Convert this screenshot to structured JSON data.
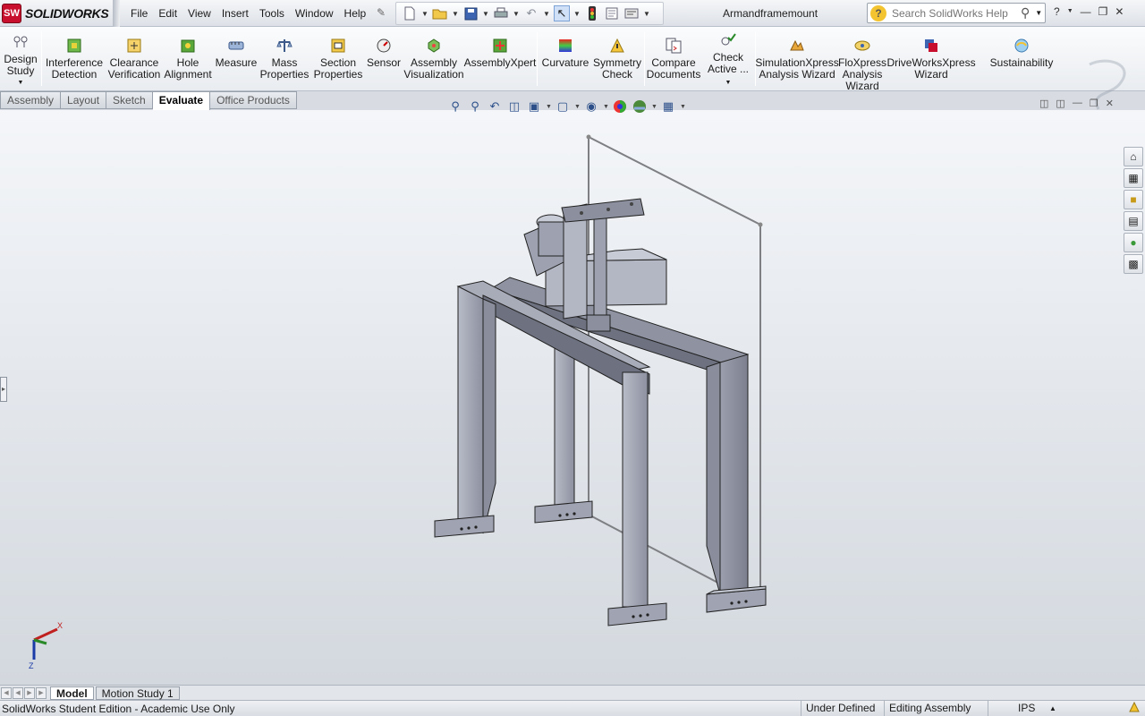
{
  "app": {
    "name": "SOLIDWORKS",
    "logo_mark": "SW",
    "document_title": "Armandframemount"
  },
  "menu": [
    "File",
    "Edit",
    "View",
    "Insert",
    "Tools",
    "Window",
    "Help"
  ],
  "quick_access": [
    "new-document-icon",
    "open-folder-icon",
    "save-icon",
    "print-icon",
    "undo-icon",
    "select-arrow-icon",
    "rebuild-traffic-light-icon",
    "options-icon"
  ],
  "search": {
    "placeholder": "Search SolidWorks Help"
  },
  "ribbon": {
    "buttons": [
      {
        "label": "Design Study",
        "icon": "design-study-icon"
      },
      {
        "label": "Interference Detection",
        "icon": "interference-detection-icon"
      },
      {
        "label": "Clearance Verification",
        "icon": "clearance-verification-icon"
      },
      {
        "label": "Hole Alignment",
        "icon": "hole-alignment-icon"
      },
      {
        "label": "Measure",
        "icon": "measure-icon"
      },
      {
        "label": "Mass Properties",
        "icon": "mass-properties-icon"
      },
      {
        "label": "Section Properties",
        "icon": "section-properties-icon"
      },
      {
        "label": "Sensor",
        "icon": "sensor-icon"
      },
      {
        "label": "Assembly Visualization",
        "icon": "assembly-visualization-icon"
      },
      {
        "label": "AssemblyXpert",
        "icon": "assemblyxpert-icon"
      },
      {
        "label": "Curvature",
        "icon": "curvature-icon"
      },
      {
        "label": "Symmetry Check",
        "icon": "symmetry-check-icon"
      },
      {
        "label": "Compare Documents",
        "icon": "compare-documents-icon"
      },
      {
        "label": "Check Active ...",
        "icon": "check-active-icon"
      },
      {
        "label": "SimulationXpress Analysis Wizard",
        "icon": "simulationxpress-icon"
      },
      {
        "label": "FloXpress Analysis Wizard",
        "icon": "floxpress-icon"
      },
      {
        "label": "DriveWorksXpress Wizard",
        "icon": "driveworksxpress-icon"
      },
      {
        "label": "Sustainability",
        "icon": "sustainability-icon"
      }
    ]
  },
  "tabs": [
    {
      "label": "Assembly",
      "active": false
    },
    {
      "label": "Layout",
      "active": false
    },
    {
      "label": "Sketch",
      "active": false
    },
    {
      "label": "Evaluate",
      "active": true
    },
    {
      "label": "Office Products",
      "active": false
    }
  ],
  "bottom_tabs": [
    {
      "label": "Model",
      "active": true
    },
    {
      "label": "Motion Study 1",
      "active": false
    }
  ],
  "triad": {
    "x_label": "X",
    "z_label": "Z"
  },
  "status": {
    "left": "SolidWorks Student Edition - Academic Use Only",
    "definition": "Under Defined",
    "mode": "Editing Assembly",
    "units": "IPS"
  },
  "colors": {
    "accent_red": "#c8102e",
    "part_gray": "#a8acb8",
    "part_dark": "#6e7280"
  }
}
